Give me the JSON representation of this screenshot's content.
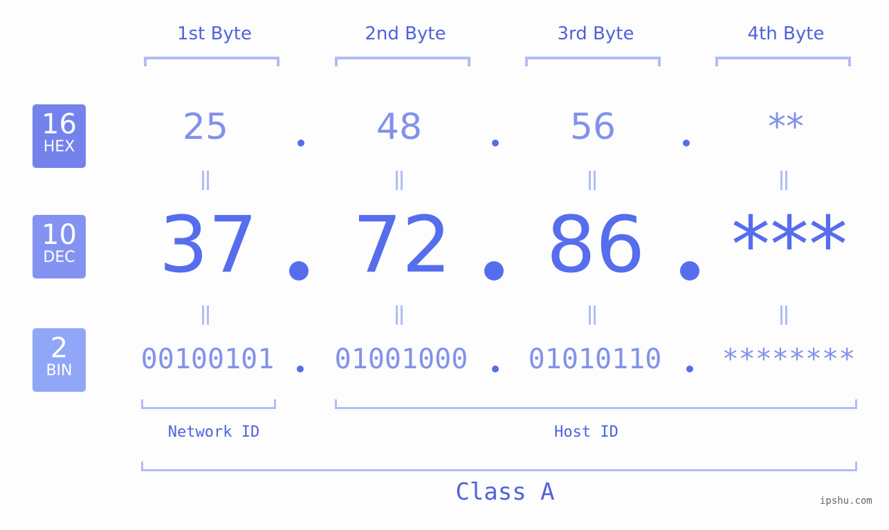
{
  "bytes": {
    "headers": [
      "1st Byte",
      "2nd Byte",
      "3rd Byte",
      "4th Byte"
    ]
  },
  "badges": [
    {
      "num": "16",
      "label": "HEX",
      "color": "#7483ec"
    },
    {
      "num": "10",
      "label": "DEC",
      "color": "#8493f2"
    },
    {
      "num": "2",
      "label": "BIN",
      "color": "#90a7f8"
    }
  ],
  "hex": [
    "25",
    "48",
    "56",
    "**"
  ],
  "dec": [
    "37",
    "72",
    "86",
    "***"
  ],
  "bin": [
    "00100101",
    "01001000",
    "01010110",
    "********"
  ],
  "labels": {
    "network_id": "Network ID",
    "host_id": "Host ID",
    "class": "Class A"
  },
  "watermark": "ipshu.com",
  "colors": {
    "accent": "#566ded",
    "bracket": "#b2bbf7",
    "text": "#4f63dc"
  }
}
